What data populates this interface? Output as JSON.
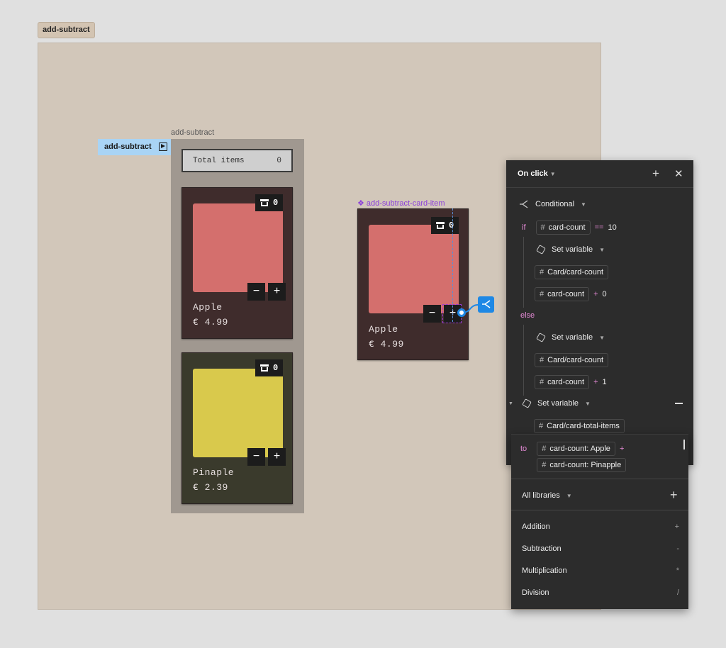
{
  "frame": {
    "title": "add-subtract"
  },
  "canvas": {
    "section_label": "add-subtract",
    "prototype_badge": "add-subtract",
    "total": {
      "label": "Total items",
      "value": "0"
    },
    "cards": [
      {
        "name": "Apple",
        "price": "€ 4.99",
        "count": "0",
        "color": "#d46f6d",
        "bg": "#3f2c2c",
        "minus": "−",
        "plus": "+"
      },
      {
        "name": "Pinaple",
        "price": "€ 2.39",
        "count": "0",
        "color": "#d9c94c",
        "bg": "#3a3a2c",
        "minus": "−",
        "plus": "+"
      }
    ],
    "component": {
      "label": "❖ add-subtract-card-item",
      "name": "Apple",
      "price": "€ 4.99",
      "count": "0",
      "color": "#d46f6d",
      "bg": "#3f2c2c",
      "minus": "−",
      "plus": "+"
    }
  },
  "panel": {
    "trigger": "On click",
    "conditional": "Conditional",
    "if_kw": "if",
    "condition": {
      "var": "card-count",
      "op": "==",
      "value": "10"
    },
    "then_action": "Set variable",
    "then_target": "Card/card-count",
    "then_expr": {
      "var": "card-count",
      "op": "+",
      "value": "0"
    },
    "else_kw": "else",
    "else_action": "Set variable",
    "else_target": "Card/card-count",
    "else_expr": {
      "var": "card-count",
      "op": "+",
      "value": "1"
    },
    "final_action": "Set variable",
    "final_target": "Card/card-total-items",
    "to_kw": "to",
    "to_expr": {
      "var1": "card-count: Apple",
      "op": "+",
      "var2": "card-count: Pinapple"
    }
  },
  "dropdown": {
    "library": "All libraries",
    "items": [
      {
        "label": "Addition",
        "symbol": "+"
      },
      {
        "label": "Subtraction",
        "symbol": "-"
      },
      {
        "label": "Multiplication",
        "symbol": "*"
      },
      {
        "label": "Division",
        "symbol": "/"
      }
    ]
  },
  "colors": {
    "accent": "#1e88e5",
    "component": "#8b3fd9",
    "keyword": "#e58ad6"
  }
}
